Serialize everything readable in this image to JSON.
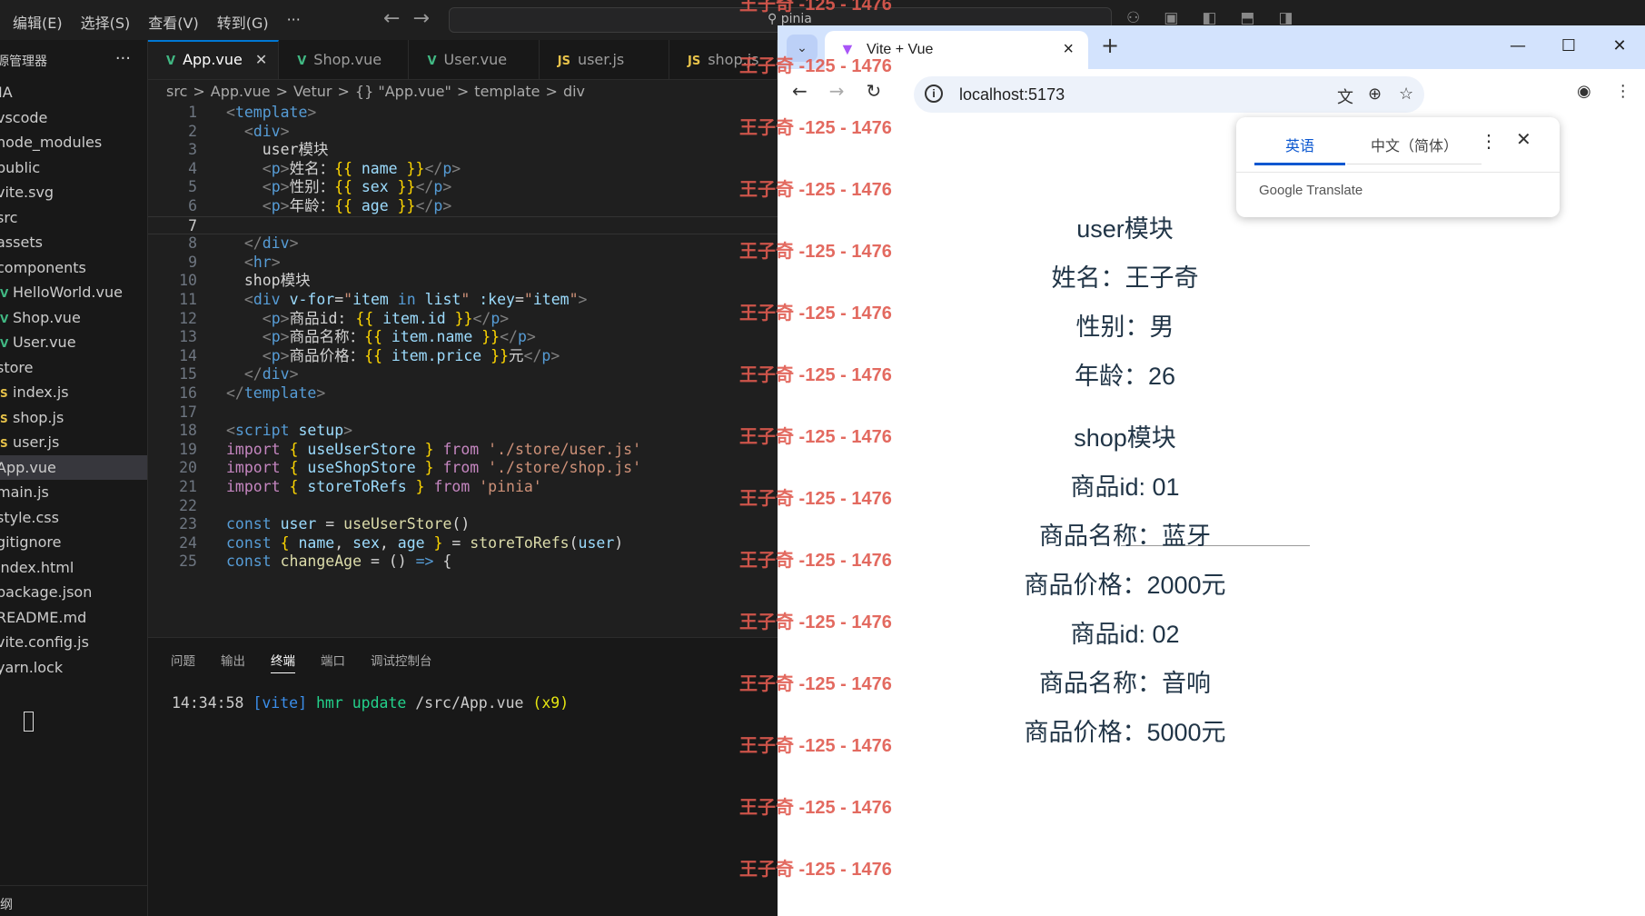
{
  "vscode": {
    "menu": [
      "编辑(E)",
      "选择(S)",
      "查看(V)",
      "转到(G)",
      "···"
    ],
    "search_text": "pinia",
    "sidebar": {
      "title": "资源管理器",
      "more": "···",
      "items": [
        {
          "label": "IA",
          "icon": ""
        },
        {
          "label": "vscode",
          "icon": ""
        },
        {
          "label": "node_modules",
          "icon": ""
        },
        {
          "label": "public",
          "icon": ""
        },
        {
          "label": "vite.svg",
          "icon": ""
        },
        {
          "label": "src",
          "icon": ""
        },
        {
          "label": "assets",
          "icon": ""
        },
        {
          "label": "components",
          "icon": ""
        },
        {
          "label": "HelloWorld.vue",
          "icon": "vue-icon"
        },
        {
          "label": "Shop.vue",
          "icon": "vue-icon"
        },
        {
          "label": "User.vue",
          "icon": "vue-icon"
        },
        {
          "label": "store",
          "icon": ""
        },
        {
          "label": "index.js",
          "icon": "js-icon"
        },
        {
          "label": "shop.js",
          "icon": "js-icon"
        },
        {
          "label": "user.js",
          "icon": "js-icon"
        },
        {
          "label": "App.vue",
          "icon": ""
        },
        {
          "label": "main.js",
          "icon": ""
        },
        {
          "label": "style.css",
          "icon": ""
        },
        {
          "label": "gitignore",
          "icon": ""
        },
        {
          "label": "index.html",
          "icon": ""
        },
        {
          "label": "package.json",
          "icon": ""
        },
        {
          "label": "README.md",
          "icon": ""
        },
        {
          "label": "vite.config.js",
          "icon": ""
        },
        {
          "label": "yarn.lock",
          "icon": ""
        }
      ],
      "active_index": 15,
      "footer": "大纲"
    },
    "tabs": [
      {
        "label": "App.vue",
        "icon": "vue-icon",
        "active": true
      },
      {
        "label": "Shop.vue",
        "icon": "vue-icon",
        "active": false
      },
      {
        "label": "User.vue",
        "icon": "vue-icon",
        "active": false
      },
      {
        "label": "user.js",
        "icon": "js-icon",
        "active": false
      },
      {
        "label": "shop.js",
        "icon": "js-icon",
        "active": false
      }
    ],
    "breadcrumb": [
      "src",
      ">",
      "App.vue",
      ">",
      "Vetur",
      ">",
      "{} \"App.vue\"",
      ">",
      "template",
      ">",
      "div"
    ],
    "current_line": 7,
    "code_lines": [
      [
        [
          "t-br",
          "<"
        ],
        [
          "t-tag",
          "template"
        ],
        [
          "t-br",
          ">"
        ]
      ],
      [
        [
          "t-txt",
          "  "
        ],
        [
          "t-br",
          "<"
        ],
        [
          "t-tag",
          "div"
        ],
        [
          "t-br",
          ">"
        ]
      ],
      [
        [
          "t-txt",
          "    user模块"
        ]
      ],
      [
        [
          "t-txt",
          "    "
        ],
        [
          "t-br",
          "<"
        ],
        [
          "t-tag",
          "p"
        ],
        [
          "t-br",
          ">"
        ],
        [
          "t-txt",
          "姓名："
        ],
        [
          "t-mus",
          "{{ "
        ],
        [
          "t-var",
          "name"
        ],
        [
          "t-mus",
          " }}"
        ],
        [
          "t-br",
          "</"
        ],
        [
          "t-tag",
          "p"
        ],
        [
          "t-br",
          ">"
        ]
      ],
      [
        [
          "t-txt",
          "    "
        ],
        [
          "t-br",
          "<"
        ],
        [
          "t-tag",
          "p"
        ],
        [
          "t-br",
          ">"
        ],
        [
          "t-txt",
          "性别："
        ],
        [
          "t-mus",
          "{{ "
        ],
        [
          "t-var",
          "sex"
        ],
        [
          "t-mus",
          " }}"
        ],
        [
          "t-br",
          "</"
        ],
        [
          "t-tag",
          "p"
        ],
        [
          "t-br",
          ">"
        ]
      ],
      [
        [
          "t-txt",
          "    "
        ],
        [
          "t-br",
          "<"
        ],
        [
          "t-tag",
          "p"
        ],
        [
          "t-br",
          ">"
        ],
        [
          "t-txt",
          "年龄："
        ],
        [
          "t-mus",
          "{{ "
        ],
        [
          "t-var",
          "age"
        ],
        [
          "t-mus",
          " }}"
        ],
        [
          "t-br",
          "</"
        ],
        [
          "t-tag",
          "p"
        ],
        [
          "t-br",
          ">"
        ]
      ],
      [
        [
          "t-txt",
          "    "
        ]
      ],
      [
        [
          "t-txt",
          "  "
        ],
        [
          "t-br",
          "</"
        ],
        [
          "t-tag",
          "div"
        ],
        [
          "t-br",
          ">"
        ]
      ],
      [
        [
          "t-txt",
          "  "
        ],
        [
          "t-br",
          "<"
        ],
        [
          "t-tag",
          "hr"
        ],
        [
          "t-br",
          ">"
        ]
      ],
      [
        [
          "t-txt",
          "  shop模块"
        ]
      ],
      [
        [
          "t-txt",
          "  "
        ],
        [
          "t-br",
          "<"
        ],
        [
          "t-tag",
          "div"
        ],
        [
          "t-txt",
          " "
        ],
        [
          "t-attr",
          "v-for"
        ],
        [
          "t-txt",
          "="
        ],
        [
          "t-str",
          "\""
        ],
        [
          "t-var",
          "item"
        ],
        [
          "t-dkw",
          " in "
        ],
        [
          "t-var",
          "list"
        ],
        [
          "t-str",
          "\""
        ],
        [
          "t-txt",
          " "
        ],
        [
          "t-attr",
          ":key"
        ],
        [
          "t-txt",
          "="
        ],
        [
          "t-str",
          "\""
        ],
        [
          "t-var",
          "item"
        ],
        [
          "t-str",
          "\""
        ],
        [
          "t-br",
          ">"
        ]
      ],
      [
        [
          "t-txt",
          "    "
        ],
        [
          "t-br",
          "<"
        ],
        [
          "t-tag",
          "p"
        ],
        [
          "t-br",
          ">"
        ],
        [
          "t-txt",
          "商品id: "
        ],
        [
          "t-mus",
          "{{ "
        ],
        [
          "t-var",
          "item.id"
        ],
        [
          "t-mus",
          " }}"
        ],
        [
          "t-br",
          "</"
        ],
        [
          "t-tag",
          "p"
        ],
        [
          "t-br",
          ">"
        ]
      ],
      [
        [
          "t-txt",
          "    "
        ],
        [
          "t-br",
          "<"
        ],
        [
          "t-tag",
          "p"
        ],
        [
          "t-br",
          ">"
        ],
        [
          "t-txt",
          "商品名称："
        ],
        [
          "t-mus",
          "{{ "
        ],
        [
          "t-var",
          "item.name"
        ],
        [
          "t-mus",
          " }}"
        ],
        [
          "t-br",
          "</"
        ],
        [
          "t-tag",
          "p"
        ],
        [
          "t-br",
          ">"
        ]
      ],
      [
        [
          "t-txt",
          "    "
        ],
        [
          "t-br",
          "<"
        ],
        [
          "t-tag",
          "p"
        ],
        [
          "t-br",
          ">"
        ],
        [
          "t-txt",
          "商品价格："
        ],
        [
          "t-mus",
          "{{ "
        ],
        [
          "t-var",
          "item.price"
        ],
        [
          "t-mus",
          " }}"
        ],
        [
          "t-txt",
          "元"
        ],
        [
          "t-br",
          "</"
        ],
        [
          "t-tag",
          "p"
        ],
        [
          "t-br",
          ">"
        ]
      ],
      [
        [
          "t-txt",
          "  "
        ],
        [
          "t-br",
          "</"
        ],
        [
          "t-tag",
          "div"
        ],
        [
          "t-br",
          ">"
        ]
      ],
      [
        [
          "t-br",
          "</"
        ],
        [
          "t-tag",
          "template"
        ],
        [
          "t-br",
          ">"
        ]
      ],
      [
        [
          "t-txt",
          ""
        ]
      ],
      [
        [
          "t-br",
          "<"
        ],
        [
          "t-tag",
          "script"
        ],
        [
          "t-txt",
          " "
        ],
        [
          "t-attr",
          "setup"
        ],
        [
          "t-br",
          ">"
        ]
      ],
      [
        [
          "t-kw",
          "import"
        ],
        [
          "t-mus",
          " { "
        ],
        [
          "t-var",
          "useUserStore"
        ],
        [
          "t-mus",
          " } "
        ],
        [
          "t-kw",
          "from"
        ],
        [
          "t-txt",
          " "
        ],
        [
          "t-str",
          "'./store/user.js'"
        ]
      ],
      [
        [
          "t-kw",
          "import"
        ],
        [
          "t-mus",
          " { "
        ],
        [
          "t-var",
          "useShopStore"
        ],
        [
          "t-mus",
          " } "
        ],
        [
          "t-kw",
          "from"
        ],
        [
          "t-txt",
          " "
        ],
        [
          "t-str",
          "'./store/shop.js'"
        ]
      ],
      [
        [
          "t-kw",
          "import"
        ],
        [
          "t-mus",
          " { "
        ],
        [
          "t-var",
          "storeToRefs"
        ],
        [
          "t-mus",
          " } "
        ],
        [
          "t-kw",
          "from"
        ],
        [
          "t-txt",
          " "
        ],
        [
          "t-str",
          "'pinia'"
        ]
      ],
      [
        [
          "t-txt",
          ""
        ]
      ],
      [
        [
          "t-dkw",
          "const"
        ],
        [
          "t-txt",
          " "
        ],
        [
          "t-var",
          "user"
        ],
        [
          "t-txt",
          " = "
        ],
        [
          "t-fn",
          "useUserStore"
        ],
        [
          "t-txt",
          "()"
        ]
      ],
      [
        [
          "t-dkw",
          "const"
        ],
        [
          "t-mus",
          " { "
        ],
        [
          "t-var",
          "name"
        ],
        [
          "t-txt",
          ", "
        ],
        [
          "t-var",
          "sex"
        ],
        [
          "t-txt",
          ", "
        ],
        [
          "t-var",
          "age"
        ],
        [
          "t-mus",
          " }"
        ],
        [
          "t-txt",
          " = "
        ],
        [
          "t-fn",
          "storeToRefs"
        ],
        [
          "t-txt",
          "("
        ],
        [
          "t-var",
          "user"
        ],
        [
          "t-txt",
          ")"
        ]
      ],
      [
        [
          "t-dkw",
          "const"
        ],
        [
          "t-txt",
          " "
        ],
        [
          "t-fn",
          "changeAge"
        ],
        [
          "t-txt",
          " = () "
        ],
        [
          "t-dkw",
          "=>"
        ],
        [
          "t-txt",
          " {"
        ]
      ]
    ],
    "panel": {
      "tabs": [
        "问题",
        "输出",
        "终端",
        "端口",
        "调试控制台"
      ],
      "active_tab": 2,
      "terminal": {
        "time": "14:34:58",
        "tag": "[vite]",
        "msg": "hmr update",
        "path": "/src/App.vue",
        "count": "(x9)"
      }
    }
  },
  "chrome": {
    "tab_title": "Vite + Vue",
    "url": "localhost:5173",
    "translate": {
      "tab_source": "英语",
      "tab_target": "中文（简体）",
      "brand": "Google Translate"
    },
    "page": {
      "lines": [
        "user模块",
        "姓名：王子奇",
        "性别：男",
        "年龄：26",
        "shop模块",
        "商品id: 01",
        "商品名称：蓝牙",
        "商品价格：2000元",
        "商品id: 02",
        "商品名称：音响",
        "商品价格：5000元"
      ]
    }
  },
  "watermark": "王子奇 -125 - 1476"
}
